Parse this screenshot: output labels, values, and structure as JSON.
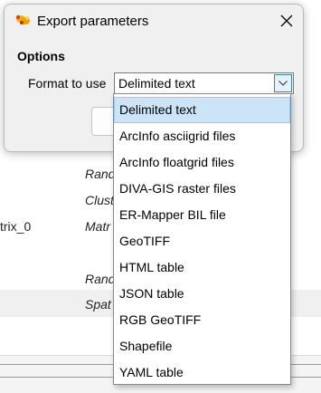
{
  "background": {
    "items": [
      {
        "text": "Rand",
        "italic": true
      },
      {
        "text": "Clust",
        "italic": true
      },
      {
        "text": "trix_0",
        "italic": false
      },
      {
        "text": "Matr",
        "italic": true
      },
      {
        "text": "Rand",
        "italic": true
      },
      {
        "text": "Spat",
        "italic": true
      }
    ]
  },
  "dialog": {
    "title": "Export parameters",
    "icon": "app-logo-icon",
    "close_icon": "close-icon",
    "options_heading": "Options",
    "format_label": "Format to use",
    "format_value": "Delimited text",
    "dropdown_icon": "chevron-down-icon"
  },
  "dropdown": {
    "selected_index": 0,
    "options": [
      "Delimited text",
      "ArcInfo asciigrid files",
      "ArcInfo floatgrid files",
      "DIVA-GIS raster files",
      "ER-Mapper BIL file",
      "GeoTIFF",
      "HTML table",
      "JSON table",
      "RGB GeoTIFF",
      "Shapefile",
      "YAML table"
    ]
  },
  "colors": {
    "selection_bg": "#cce4f7",
    "selection_border": "#99c9ef",
    "dialog_bg": "#f0f0f0",
    "combo_arrow_border": "#3c7fb1"
  }
}
